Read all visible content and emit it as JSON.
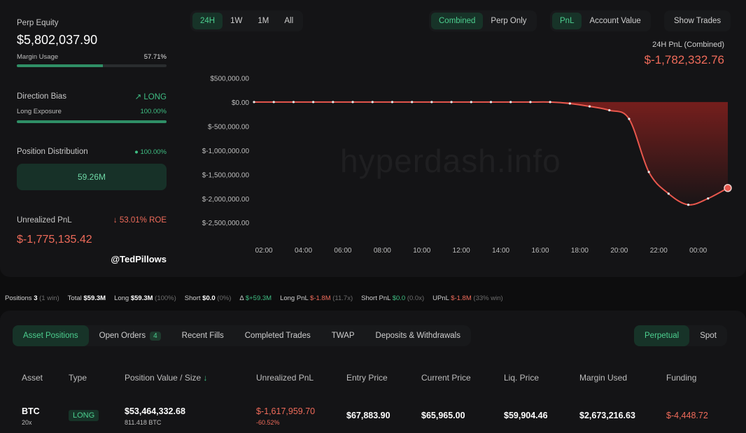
{
  "summary_card": {
    "perp_equity_label": "Perp Equity",
    "perp_equity_value": "$5,802,037.90",
    "margin_usage_label": "Margin Usage",
    "margin_usage_value": "57.71%",
    "margin_usage_fraction": 0.5771,
    "direction_bias_label": "Direction Bias",
    "direction_bias_value": "LONG",
    "long_exposure_label": "Long Exposure",
    "long_exposure_value": "100.00%",
    "long_exposure_fraction": 1.0,
    "position_distribution_label": "Position Distribution",
    "position_distribution_value": "100.00%",
    "position_distribution_box": "59.26M",
    "unrealized_pnl_label": "Unrealized PnL",
    "unrealized_pnl_roe": "53.01% ROE",
    "unrealized_pnl_value": "$-1,775,135.42",
    "handle": "@TedPillows"
  },
  "time_tabs": [
    "24H",
    "1W",
    "1M",
    "All"
  ],
  "mode_tabs": [
    "Combined",
    "Perp Only"
  ],
  "metric_tabs": [
    "PnL",
    "Account Value"
  ],
  "show_trades_label": "Show Trades",
  "chart_header": {
    "label": "24H PnL (Combined)",
    "value": "$-1,782,332.76"
  },
  "watermark": "hyperdash.info",
  "chart_data": {
    "type": "area",
    "title": "24H PnL (Combined)",
    "x": [
      "01:30",
      "02:30",
      "03:30",
      "04:30",
      "05:30",
      "06:30",
      "07:30",
      "08:30",
      "09:30",
      "10:30",
      "11:30",
      "12:30",
      "13:30",
      "14:30",
      "15:30",
      "16:30",
      "17:30",
      "18:30",
      "19:30",
      "20:30",
      "21:30",
      "22:30",
      "23:30",
      "00:30",
      "01:00"
    ],
    "x_ticks": [
      "02:00",
      "04:00",
      "06:00",
      "08:00",
      "10:00",
      "12:00",
      "14:00",
      "16:00",
      "18:00",
      "20:00",
      "22:00",
      "00:00"
    ],
    "y": [
      0,
      0,
      0,
      0,
      0,
      0,
      0,
      0,
      0,
      0,
      0,
      0,
      0,
      0,
      0,
      0,
      -30000,
      -90000,
      -170000,
      -350000,
      -1450000,
      -1900000,
      -2130000,
      -2000000,
      -1782332.76
    ],
    "y_ticks": [
      "$500,000.00",
      "$0.00",
      "$-500,000.00",
      "$-1,000,000.00",
      "$-1,500,000.00",
      "$-2,000,000.00",
      "$-2,500,000.00"
    ],
    "ylim": [
      -2700000,
      550000
    ],
    "line_color": "#e8574d",
    "fill_color": "#7a1f1d"
  },
  "stats_bar": {
    "positions_label": "Positions",
    "positions_value": "3",
    "positions_note": "(1 win)",
    "total_label": "Total",
    "total_value": "$59.3M",
    "long_label": "Long",
    "long_value": "$59.3M",
    "long_note": "(100%)",
    "short_label": "Short",
    "short_value": "$0.0",
    "short_note": "(0%)",
    "delta_label": "Δ",
    "delta_value": "$+59.3M",
    "long_pnl_label": "Long PnL",
    "long_pnl_value": "$-1.8M",
    "long_pnl_note": "(11.7x)",
    "short_pnl_label": "Short PnL",
    "short_pnl_value": "$0.0",
    "short_pnl_note": "(0.0x)",
    "upnl_label": "UPnL",
    "upnl_value": "$-1.8M",
    "upnl_note": "(33% win)"
  },
  "bottom_tabs": {
    "asset_positions": "Asset Positions",
    "open_orders": "Open Orders",
    "open_orders_count": "4",
    "recent_fills": "Recent Fills",
    "completed_trades": "Completed Trades",
    "twap": "TWAP",
    "deposits": "Deposits & Withdrawals",
    "perpetual": "Perpetual",
    "spot": "Spot"
  },
  "table": {
    "headers": [
      "Asset",
      "Type",
      "Position Value / Size",
      "Unrealized PnL",
      "Entry Price",
      "Current Price",
      "Liq. Price",
      "Margin Used",
      "Funding"
    ],
    "sort_arrow": "↓",
    "row": {
      "asset": "BTC",
      "leverage": "20x",
      "type": "LONG",
      "position_value": "$53,464,332.68",
      "size": "811.418 BTC",
      "upnl": "$-1,617,959.70",
      "upnl_pct": "-60.52%",
      "entry": "$67,883.90",
      "current": "$65,965.00",
      "liq": "$59,904.46",
      "margin": "$2,673,216.63",
      "funding": "$-4,448.72"
    }
  }
}
